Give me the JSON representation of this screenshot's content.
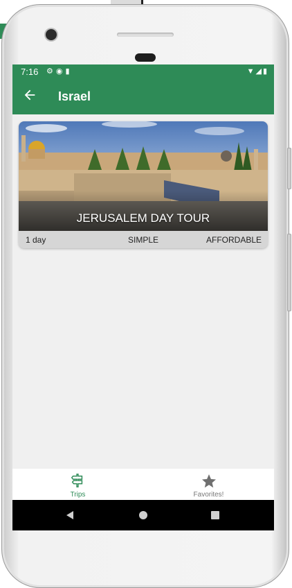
{
  "status_bar": {
    "time": "7:16",
    "left_icons": [
      "gear-icon",
      "vpn-icon",
      "sim-icon"
    ],
    "right_icons": [
      "wifi-icon",
      "signal-icon",
      "battery-icon"
    ]
  },
  "app_bar": {
    "title": "Israel",
    "back_icon": "arrow-back-icon",
    "color": "#2e8b57"
  },
  "trip_card": {
    "title": "JERUSALEM DAY TOUR",
    "duration": "1 day",
    "complexity": "SIMPLE",
    "affordability": "AFFORDABLE"
  },
  "bottom_nav": {
    "items": [
      {
        "label": "Trips",
        "icon": "signpost-icon",
        "active": true
      },
      {
        "label": "Favorites!",
        "icon": "star-icon",
        "active": false
      }
    ],
    "active_color": "#2e8b57",
    "inactive_color": "#777777"
  },
  "system_nav": [
    "back-triangle-icon",
    "home-circle-icon",
    "recents-square-icon"
  ]
}
